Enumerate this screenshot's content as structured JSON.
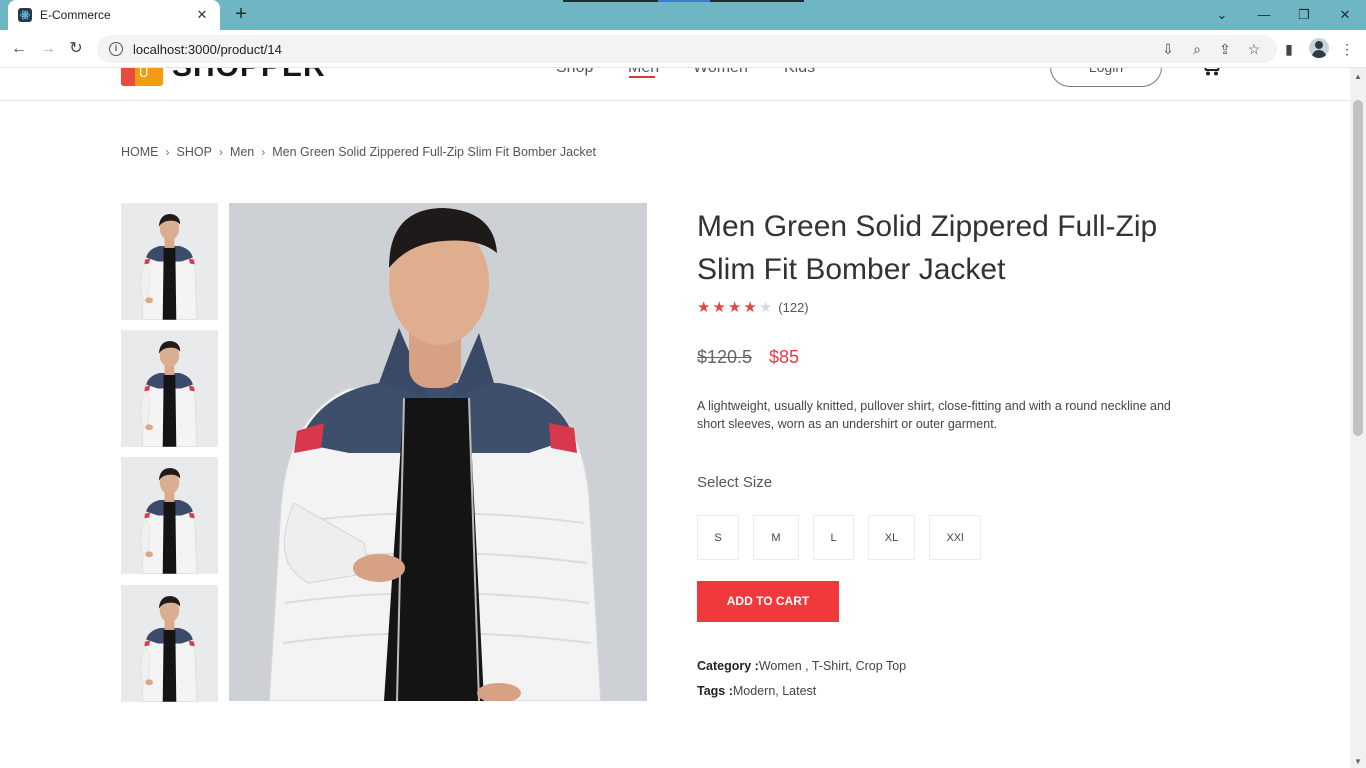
{
  "browser": {
    "tab_title": "E-Commerce",
    "url": "localhost:3000/product/14"
  },
  "header": {
    "logo_mark": "U",
    "logo_text": "SHOPPER",
    "nav": [
      "Shop",
      "Men",
      "Women",
      "Kids"
    ],
    "active_nav": "Men",
    "login_label": "Login"
  },
  "breadcrumb": [
    "HOME",
    "SHOP",
    "Men",
    "Men Green Solid Zippered Full-Zip Slim Fit Bomber Jacket"
  ],
  "product": {
    "title": "Men Green Solid Zippered Full-Zip Slim Fit Bomber Jacket",
    "rating": 4,
    "rating_max": 5,
    "rating_count": "(122)",
    "old_price": "$120.5",
    "new_price": "$85",
    "description": "A lightweight, usually knitted, pullover shirt, close-fitting and with a round neckline and short sleeves, worn as an undershirt or outer garment.",
    "size_label": "Select Size",
    "sizes": [
      "S",
      "M",
      "L",
      "XL",
      "XXl"
    ],
    "add_to_cart": "ADD TO CART",
    "category_label": "Category :",
    "category_value": "Women , T-Shirt, Crop Top",
    "tags_label": "Tags :",
    "tags_value": "Modern, Latest",
    "thumbnail_count": 4
  },
  "colors": {
    "accent": "#f0383d",
    "price_red": "#e63946",
    "star_filled": "#e8453c",
    "star_empty": "#d9d9d9",
    "tab_strip": "#6fb6c4"
  }
}
